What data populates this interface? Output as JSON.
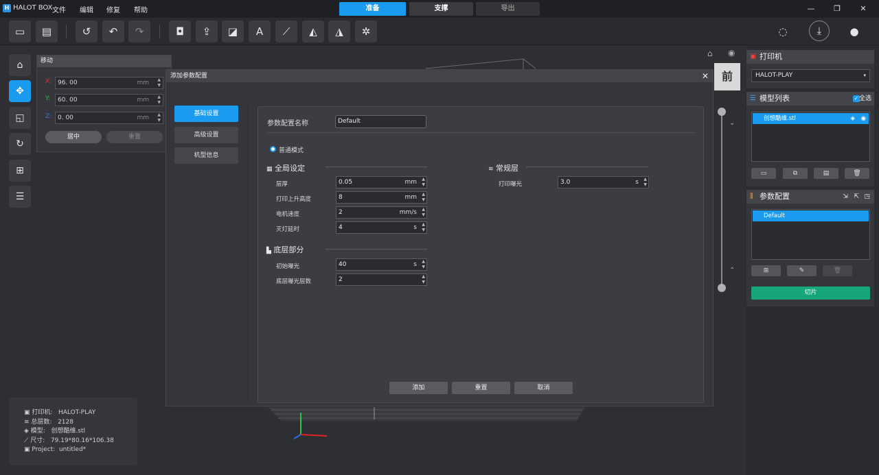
{
  "app": {
    "title": "HALOT BOX",
    "menus": [
      "文件",
      "编辑",
      "修复",
      "帮助"
    ]
  },
  "stages": [
    {
      "label": "准备",
      "active": true
    },
    {
      "label": "支撑",
      "active": false
    },
    {
      "label": "导出",
      "active": false
    }
  ],
  "toolbar": {
    "tools": [
      "open-folder-icon",
      "import-icon",
      "history-icon",
      "undo-icon",
      "redo-icon",
      "hollow-icon",
      "export-icon",
      "split-icon",
      "text-icon",
      "measure-icon",
      "fill-icon",
      "mirror-icon",
      "support-icon"
    ]
  },
  "left_tools": [
    "auto-arrange-icon",
    "move-icon",
    "scale-icon",
    "rotate-icon",
    "add-icon",
    "list-icon"
  ],
  "move_panel": {
    "title": "移动",
    "x_label": "X:",
    "x_value": "96. 00",
    "y_label": "Y:",
    "y_value": "60. 00",
    "z_label": "Z:",
    "z_value": "0. 00",
    "unit": "mm",
    "center_label": "居中",
    "reset_label": "重置"
  },
  "status": {
    "printer_label": "打印机:",
    "printer_value": "HALOT-PLAY",
    "layers_label": "总层数:",
    "layers_value": "2128",
    "model_label": "模型:",
    "model_value": "创想酷维.stl",
    "size_label": "尺寸:",
    "size_value": "79.19*80.16*106.38",
    "project_label": "Project:",
    "project_value": "untitled*"
  },
  "dialog": {
    "title": "添加参数配置",
    "tabs": [
      {
        "label": "基础设置",
        "active": true
      },
      {
        "label": "高级设置",
        "active": false
      },
      {
        "label": "机型信息",
        "active": false
      }
    ],
    "name_label": "参数配置名称",
    "name_value": "Default",
    "mode_label": "普通模式",
    "global": {
      "title": "全局设定",
      "params": [
        {
          "label": "层厚",
          "value": "0.05",
          "unit": "mm"
        },
        {
          "label": "打印上升高度",
          "value": "8",
          "unit": "mm"
        },
        {
          "label": "电机速度",
          "value": "2",
          "unit": "mm/s"
        },
        {
          "label": "灭灯延时",
          "value": "4",
          "unit": "s"
        }
      ]
    },
    "normal": {
      "title": "常规层",
      "params": [
        {
          "label": "打印曝光",
          "value": "3.0",
          "unit": "s"
        }
      ]
    },
    "bottom": {
      "title": "底层部分",
      "params": [
        {
          "label": "初始曝光",
          "value": "40",
          "unit": "s"
        },
        {
          "label": "底层曝光层数",
          "value": "2",
          "unit": ""
        }
      ]
    },
    "add_label": "添加",
    "reset_label": "重置",
    "cancel_label": "取消"
  },
  "view_cube": {
    "face_label": "前"
  },
  "right": {
    "printer_title": "打印机",
    "printer_value": "HALOT-PLAY",
    "models_title": "模型列表",
    "select_all_label": "全选",
    "model_item": "创想酷维.stl",
    "profile_title": "参数配置",
    "profile_item": "Default",
    "slice_label": "切片"
  }
}
